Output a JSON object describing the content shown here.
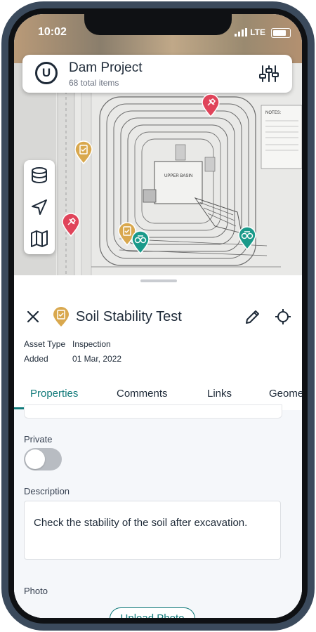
{
  "status_bar": {
    "time": "10:02",
    "network": "LTE"
  },
  "project": {
    "title": "Dam Project",
    "subtitle": "68 total items"
  },
  "map": {
    "plan_label": "UPPER BASIN",
    "notes_label": "NOTES:"
  },
  "asset": {
    "title": "Soil Stability Test",
    "meta": [
      {
        "label": "Asset Type",
        "value": "Inspection"
      },
      {
        "label": "Added",
        "value": "01 Mar, 2022"
      }
    ]
  },
  "tabs": [
    {
      "label": "Properties",
      "active": true
    },
    {
      "label": "Comments",
      "active": false
    },
    {
      "label": "Links",
      "active": false
    },
    {
      "label": "Geome",
      "active": false
    }
  ],
  "properties": {
    "private_label": "Private",
    "private_on": false,
    "description_label": "Description",
    "description_value": "Check the stability of the soil after excavation.",
    "photo_label": "Photo",
    "upload_label": "Upload Photo"
  },
  "colors": {
    "accent": "#117a7a",
    "inspection": "#d9a84e",
    "pin_red": "#e0445a",
    "pin_teal": "#1a9a8a",
    "dark": "#1e2a38"
  },
  "icons": [
    "filter-icon",
    "layers-icon",
    "navigation-icon",
    "map-icon",
    "close-icon",
    "inspection-icon",
    "edit-icon",
    "crosshair-icon"
  ]
}
